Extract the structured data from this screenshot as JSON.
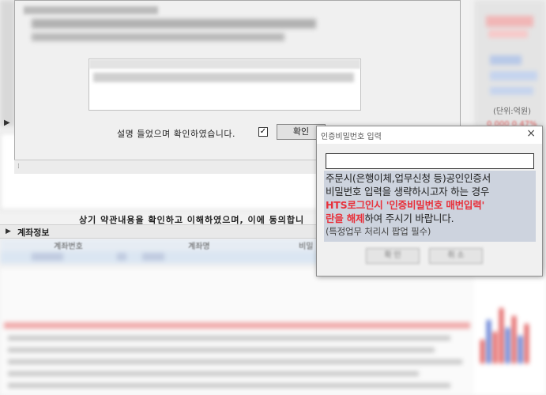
{
  "background": {
    "unit_label": "(단위:억원)",
    "right_red_text": "0.000  0.47%",
    "agreement_text": "상기 약관내용을 확인하고 이해하였으며, 이에 동의합니",
    "account_section": {
      "title": "계좌정보",
      "headers": [
        "계좌번호",
        "계좌명",
        "비밀"
      ]
    }
  },
  "first_dialog": {
    "confirm_text": "설명 들었으며 확인하였습니다.",
    "checkbox_mark": "✓",
    "ok_label": "확인"
  },
  "cert_dialog": {
    "title": "인증비밀번호 입력",
    "close_glyph": "×",
    "password_value": "",
    "message": {
      "line1": "주문시(은행이체,업무신청 등)공인인증서",
      "line2": "비밀번호 입력을 생략하시고자 하는 경우",
      "line3_red": "HTS로그인시 '인증비밀번호 매번입력'",
      "line4_red": "란을 해제",
      "line4_rest": "하여 주시기 바랍니다.",
      "line5": "(특정업무 처리시 팝업 필수)"
    },
    "buttons": [
      "확 인",
      "취 소"
    ]
  },
  "colors": {
    "message_bg": "#cdd3de",
    "warning_red": "#e8303a",
    "dialog_bg": "#f0f0f0"
  }
}
